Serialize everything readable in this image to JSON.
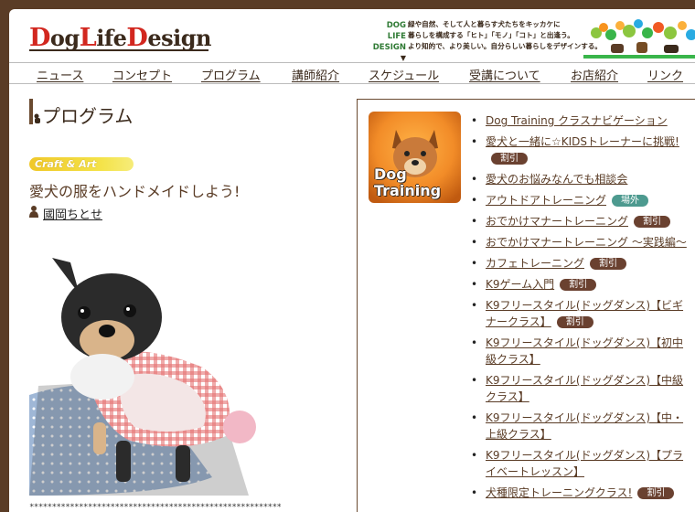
{
  "header": {
    "logo_parts": [
      "D",
      "og",
      "L",
      "ife",
      "D",
      "esign"
    ],
    "tagline_side": [
      "DOG",
      "LIFE",
      "DESIGN"
    ],
    "tagline_main": [
      "緑や自然、そして人と暮らす犬たちをキッカケに",
      "暮らしを構成する「ヒト」「モノ」「コト」と出逢う。",
      "より知的で、より美しい。自分らしい暮らしをデザインする。"
    ]
  },
  "nav": {
    "items": [
      "ニュース",
      "コンセプト",
      "プログラム",
      "講師紹介",
      "スケジュール",
      "受講について",
      "お店紹介",
      "リンク"
    ]
  },
  "main": {
    "page_title": "プログラム",
    "category": "Craft & Art",
    "article_title": "愛犬の服をハンドメイドしよう!",
    "author": "國岡ちとせ",
    "separator": "********************************************************"
  },
  "sidebar": {
    "thumb_label_1": "Dog",
    "thumb_label_2": "Training",
    "courses": [
      {
        "label": "Dog Training クラスナビゲーション",
        "tag": ""
      },
      {
        "label": "愛犬と一緒に☆KIDSトレーナーに挑戦!",
        "tag": "割引"
      },
      {
        "label": "愛犬のお悩みなんでも相談会",
        "tag": ""
      },
      {
        "label": "アウトドアトレーニング",
        "tag": "場外"
      },
      {
        "label": "おでかけマナートレーニング",
        "tag": "割引"
      },
      {
        "label": "おでかけマナートレーニング ～実践編～",
        "tag": ""
      },
      {
        "label": "カフェトレーニング",
        "tag": "割引"
      },
      {
        "label": "K9ゲーム入門",
        "tag": "割引"
      },
      {
        "label": "K9フリースタイル(ドッグダンス)【ビギナークラス】",
        "tag": "割引"
      },
      {
        "label": "K9フリースタイル(ドッグダンス)【初中級クラス】",
        "tag": ""
      },
      {
        "label": "K9フリースタイル(ドッグダンス)【中級クラス】",
        "tag": ""
      },
      {
        "label": "K9フリースタイル(ドッグダンス)【中・上級クラス】",
        "tag": ""
      },
      {
        "label": "K9フリースタイル(ドッグダンス)【プライベートレッスン】",
        "tag": ""
      },
      {
        "label": "犬種限定トレーニングクラス!",
        "tag": "割引"
      }
    ]
  },
  "colors": {
    "background": "#5a3c26",
    "logo_red": "#d2271f",
    "text_brown": "#3b2a1c",
    "tag_discount": "#6a4130",
    "tag_outside": "#4d9a8f",
    "category_yellow": "#f0c82a"
  }
}
